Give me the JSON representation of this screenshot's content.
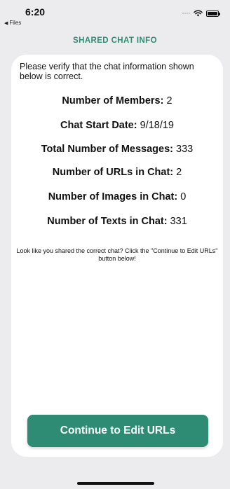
{
  "status_bar": {
    "time": "6:20",
    "back_app": "Files"
  },
  "header": {
    "title": "SHARED CHAT INFO"
  },
  "card": {
    "intro": "Please verify that the chat information shown below is correct.",
    "stats": [
      {
        "label": "Number of Members:",
        "value": "2"
      },
      {
        "label": "Chat Start Date:",
        "value": "9/18/19"
      },
      {
        "label": "Total Number of Messages:",
        "value": "333"
      },
      {
        "label": "Number of URLs in Chat:",
        "value": "2"
      },
      {
        "label": "Number of Images in Chat:",
        "value": "0"
      },
      {
        "label": "Number of Texts in Chat:",
        "value": "331"
      }
    ],
    "hint": "Look like you shared the correct chat? Click the \"Continue to Edit URLs\" button below!"
  },
  "cta": {
    "label": "Continue to Edit URLs"
  },
  "colors": {
    "accent": "#2e8b74",
    "background": "#ececef",
    "card": "#ffffff"
  }
}
